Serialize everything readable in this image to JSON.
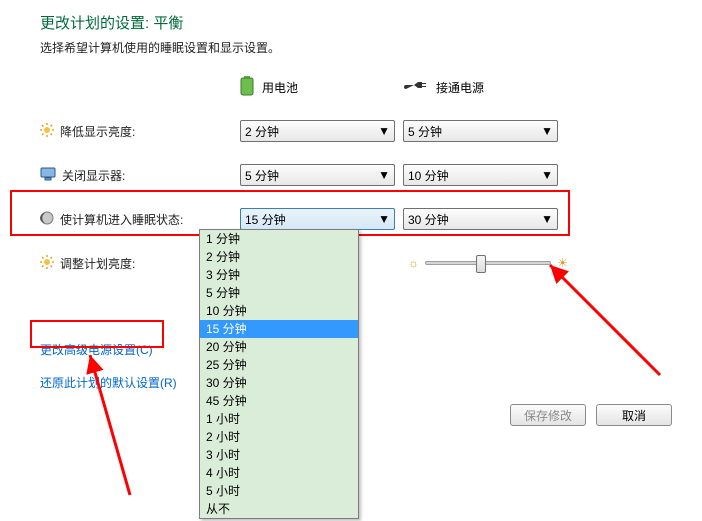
{
  "title": "更改计划的设置: 平衡",
  "subtitle": "选择希望计算机使用的睡眠设置和显示设置。",
  "columns": {
    "battery": "用电池",
    "plugged": "接通电源"
  },
  "rows": {
    "dim": {
      "label": "降低显示亮度:",
      "battery": "2 分钟",
      "plugged": "5 分钟"
    },
    "off": {
      "label": "关闭显示器:",
      "battery": "5 分钟",
      "plugged": "10 分钟"
    },
    "sleep": {
      "label": "使计算机进入睡眠状态:",
      "battery": "15 分钟",
      "plugged": "30 分钟"
    },
    "bright": {
      "label": "调整计划亮度:"
    }
  },
  "dropdown_options": [
    "1 分钟",
    "2 分钟",
    "3 分钟",
    "5 分钟",
    "10 分钟",
    "15 分钟",
    "20 分钟",
    "25 分钟",
    "30 分钟",
    "45 分钟",
    "1 小时",
    "2 小时",
    "3 小时",
    "4 小时",
    "5 小时",
    "从不"
  ],
  "dropdown_selected": "15 分钟",
  "links": {
    "advanced": "更改高级电源设置(C)",
    "restore": "还原此计划的默认设置(R)"
  },
  "buttons": {
    "save": "保存修改",
    "cancel": "取消"
  },
  "slider": {
    "battery_pos": 0.45,
    "plugged_pos": 0.55
  }
}
